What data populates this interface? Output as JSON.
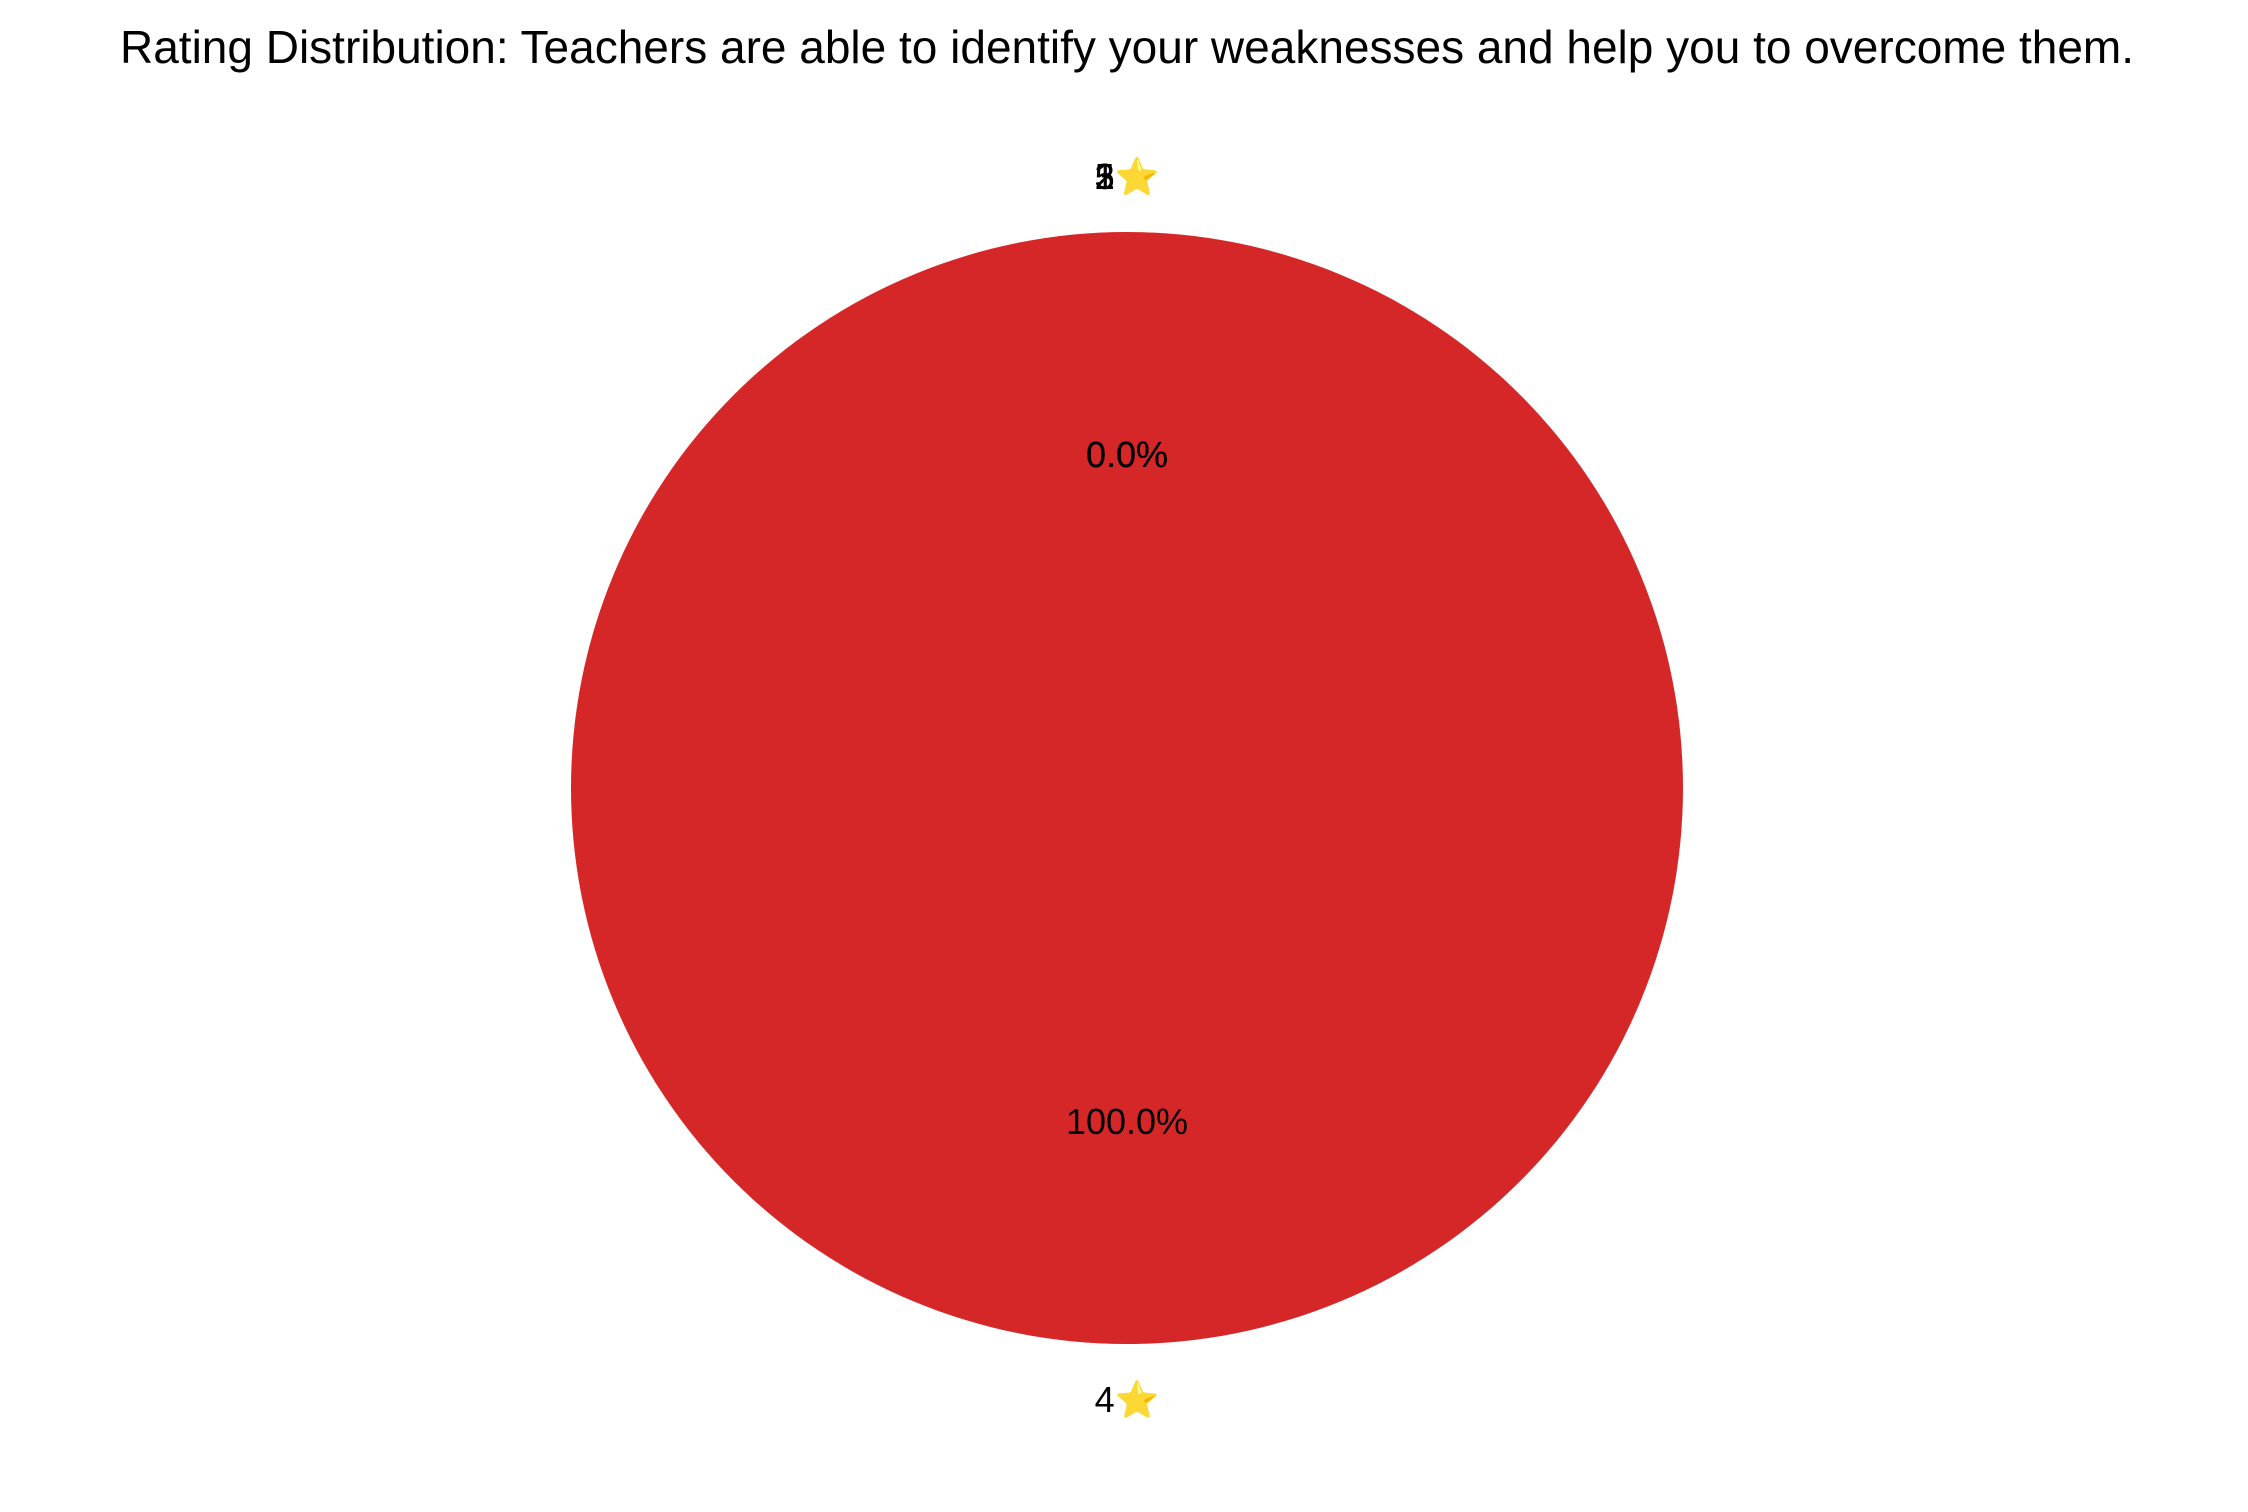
{
  "chart_data": {
    "type": "pie",
    "title": "Rating Distribution: Teachers are able to identify your weaknesses and help you to overcome them.",
    "categories": [
      "1⭐",
      "2⭐",
      "3⭐",
      "4⭐",
      "5⭐"
    ],
    "values": [
      0,
      0,
      0,
      100,
      0
    ],
    "percent_labels": [
      "0.0%",
      "0.0%",
      "0.0%",
      "100.0%",
      "0.0%"
    ],
    "colors": [
      "#1f77b4",
      "#ff7f0e",
      "#2ca02c",
      "#d62728",
      "#9467bd"
    ],
    "start_angle_deg": 90,
    "direction": "counterclockwise",
    "legend": "none"
  }
}
